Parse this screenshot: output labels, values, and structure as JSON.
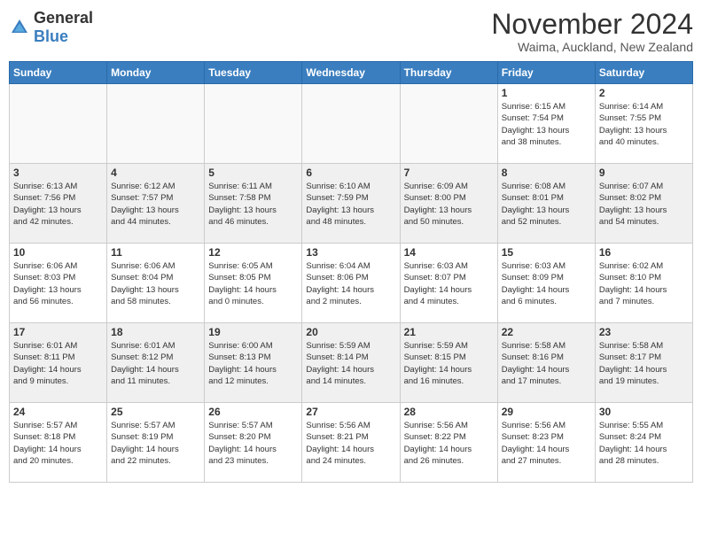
{
  "header": {
    "logo_general": "General",
    "logo_blue": "Blue",
    "month_title": "November 2024",
    "location": "Waima, Auckland, New Zealand"
  },
  "weekdays": [
    "Sunday",
    "Monday",
    "Tuesday",
    "Wednesday",
    "Thursday",
    "Friday",
    "Saturday"
  ],
  "weeks": [
    {
      "shaded": false,
      "days": [
        {
          "num": "",
          "info": ""
        },
        {
          "num": "",
          "info": ""
        },
        {
          "num": "",
          "info": ""
        },
        {
          "num": "",
          "info": ""
        },
        {
          "num": "",
          "info": ""
        },
        {
          "num": "1",
          "info": "Sunrise: 6:15 AM\nSunset: 7:54 PM\nDaylight: 13 hours\nand 38 minutes."
        },
        {
          "num": "2",
          "info": "Sunrise: 6:14 AM\nSunset: 7:55 PM\nDaylight: 13 hours\nand 40 minutes."
        }
      ]
    },
    {
      "shaded": true,
      "days": [
        {
          "num": "3",
          "info": "Sunrise: 6:13 AM\nSunset: 7:56 PM\nDaylight: 13 hours\nand 42 minutes."
        },
        {
          "num": "4",
          "info": "Sunrise: 6:12 AM\nSunset: 7:57 PM\nDaylight: 13 hours\nand 44 minutes."
        },
        {
          "num": "5",
          "info": "Sunrise: 6:11 AM\nSunset: 7:58 PM\nDaylight: 13 hours\nand 46 minutes."
        },
        {
          "num": "6",
          "info": "Sunrise: 6:10 AM\nSunset: 7:59 PM\nDaylight: 13 hours\nand 48 minutes."
        },
        {
          "num": "7",
          "info": "Sunrise: 6:09 AM\nSunset: 8:00 PM\nDaylight: 13 hours\nand 50 minutes."
        },
        {
          "num": "8",
          "info": "Sunrise: 6:08 AM\nSunset: 8:01 PM\nDaylight: 13 hours\nand 52 minutes."
        },
        {
          "num": "9",
          "info": "Sunrise: 6:07 AM\nSunset: 8:02 PM\nDaylight: 13 hours\nand 54 minutes."
        }
      ]
    },
    {
      "shaded": false,
      "days": [
        {
          "num": "10",
          "info": "Sunrise: 6:06 AM\nSunset: 8:03 PM\nDaylight: 13 hours\nand 56 minutes."
        },
        {
          "num": "11",
          "info": "Sunrise: 6:06 AM\nSunset: 8:04 PM\nDaylight: 13 hours\nand 58 minutes."
        },
        {
          "num": "12",
          "info": "Sunrise: 6:05 AM\nSunset: 8:05 PM\nDaylight: 14 hours\nand 0 minutes."
        },
        {
          "num": "13",
          "info": "Sunrise: 6:04 AM\nSunset: 8:06 PM\nDaylight: 14 hours\nand 2 minutes."
        },
        {
          "num": "14",
          "info": "Sunrise: 6:03 AM\nSunset: 8:07 PM\nDaylight: 14 hours\nand 4 minutes."
        },
        {
          "num": "15",
          "info": "Sunrise: 6:03 AM\nSunset: 8:09 PM\nDaylight: 14 hours\nand 6 minutes."
        },
        {
          "num": "16",
          "info": "Sunrise: 6:02 AM\nSunset: 8:10 PM\nDaylight: 14 hours\nand 7 minutes."
        }
      ]
    },
    {
      "shaded": true,
      "days": [
        {
          "num": "17",
          "info": "Sunrise: 6:01 AM\nSunset: 8:11 PM\nDaylight: 14 hours\nand 9 minutes."
        },
        {
          "num": "18",
          "info": "Sunrise: 6:01 AM\nSunset: 8:12 PM\nDaylight: 14 hours\nand 11 minutes."
        },
        {
          "num": "19",
          "info": "Sunrise: 6:00 AM\nSunset: 8:13 PM\nDaylight: 14 hours\nand 12 minutes."
        },
        {
          "num": "20",
          "info": "Sunrise: 5:59 AM\nSunset: 8:14 PM\nDaylight: 14 hours\nand 14 minutes."
        },
        {
          "num": "21",
          "info": "Sunrise: 5:59 AM\nSunset: 8:15 PM\nDaylight: 14 hours\nand 16 minutes."
        },
        {
          "num": "22",
          "info": "Sunrise: 5:58 AM\nSunset: 8:16 PM\nDaylight: 14 hours\nand 17 minutes."
        },
        {
          "num": "23",
          "info": "Sunrise: 5:58 AM\nSunset: 8:17 PM\nDaylight: 14 hours\nand 19 minutes."
        }
      ]
    },
    {
      "shaded": false,
      "days": [
        {
          "num": "24",
          "info": "Sunrise: 5:57 AM\nSunset: 8:18 PM\nDaylight: 14 hours\nand 20 minutes."
        },
        {
          "num": "25",
          "info": "Sunrise: 5:57 AM\nSunset: 8:19 PM\nDaylight: 14 hours\nand 22 minutes."
        },
        {
          "num": "26",
          "info": "Sunrise: 5:57 AM\nSunset: 8:20 PM\nDaylight: 14 hours\nand 23 minutes."
        },
        {
          "num": "27",
          "info": "Sunrise: 5:56 AM\nSunset: 8:21 PM\nDaylight: 14 hours\nand 24 minutes."
        },
        {
          "num": "28",
          "info": "Sunrise: 5:56 AM\nSunset: 8:22 PM\nDaylight: 14 hours\nand 26 minutes."
        },
        {
          "num": "29",
          "info": "Sunrise: 5:56 AM\nSunset: 8:23 PM\nDaylight: 14 hours\nand 27 minutes."
        },
        {
          "num": "30",
          "info": "Sunrise: 5:55 AM\nSunset: 8:24 PM\nDaylight: 14 hours\nand 28 minutes."
        }
      ]
    }
  ]
}
